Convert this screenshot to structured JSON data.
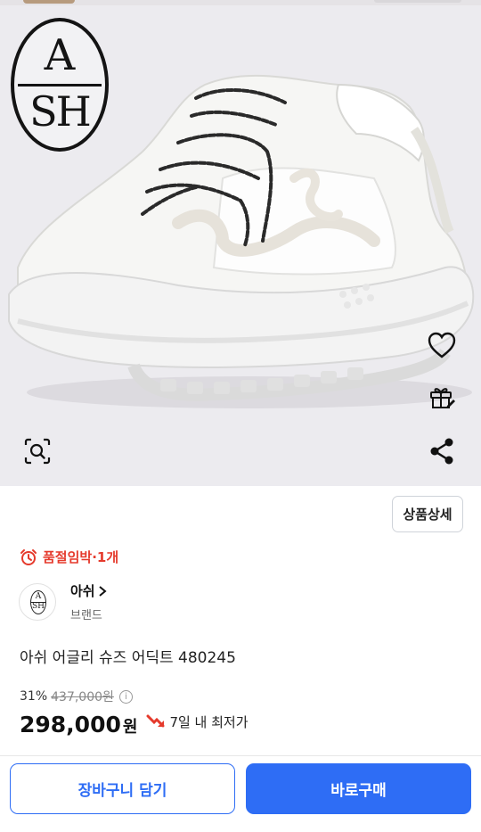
{
  "product": {
    "brand_logo_text": "ASH",
    "soldout_label": "품절임박·1개",
    "brand_name": "아쉬",
    "brand_type": "브랜드",
    "title": "아쉬 어글리 슈즈 어딕트 480245",
    "discount": "31%",
    "original_price": "437,000원",
    "price": "298,000",
    "price_unit": "원",
    "lowest_label": "7일 내 최저가",
    "detail_button": "상품상세"
  },
  "icons": {
    "heart": "heart-icon",
    "gift": "gift-icon",
    "share": "share-icon",
    "zoom": "image-search-icon",
    "alarm": "alarm-clock-icon",
    "chevron": "chevron-right-icon",
    "info": "info-icon",
    "trend_down": "trend-down-icon"
  },
  "bottom_bar": {
    "cart_label": "장바구니 담기",
    "buy_label": "바로구매"
  },
  "colors": {
    "accent": "#2e6df5",
    "alert": "#e53a2c"
  }
}
